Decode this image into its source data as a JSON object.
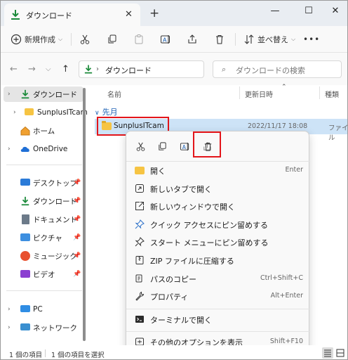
{
  "tab": {
    "title": "ダウンロード"
  },
  "window": {
    "new_tab": "+",
    "minimize": "—",
    "maximize": "☐",
    "close": "✕"
  },
  "toolbar": {
    "new_label": "新規作成",
    "sort_label": "並べ替え",
    "more": "•••"
  },
  "address": {
    "path": "ダウンロード",
    "chevron": "›",
    "search_placeholder": "ダウンロードの検索"
  },
  "sidebar": {
    "items": [
      {
        "label": "ダウンロード",
        "icon": "download-icon",
        "expander": "›"
      },
      {
        "label": "SunplusITcam",
        "icon": "folder-icon",
        "expander": "›"
      },
      {
        "label": "ホーム",
        "icon": "home-icon"
      },
      {
        "label": "OneDrive",
        "icon": "cloud-icon",
        "expander": "›"
      },
      {
        "label": "デスクトップ",
        "icon": "desktop-icon"
      },
      {
        "label": "ダウンロード",
        "icon": "download-icon"
      },
      {
        "label": "ドキュメント",
        "icon": "document-icon"
      },
      {
        "label": "ピクチャ",
        "icon": "pictures-icon"
      },
      {
        "label": "ミュージック",
        "icon": "music-icon"
      },
      {
        "label": "ビデオ",
        "icon": "video-icon"
      },
      {
        "label": "PC",
        "icon": "pc-icon",
        "expander": "›"
      },
      {
        "label": "ネットワーク",
        "icon": "network-icon",
        "expander": "›"
      }
    ]
  },
  "columns": {
    "name": "名前",
    "modified": "更新日時",
    "type": "種類"
  },
  "group": {
    "label": "先月",
    "expander": "∨"
  },
  "files": [
    {
      "name": "SunplusITcam",
      "date": "2022/11/17 18:08",
      "type": "ファイル"
    }
  ],
  "context_menu": {
    "items": [
      {
        "label": "開く",
        "shortcut": "Enter",
        "icon": "open-folder-icon"
      },
      {
        "label": "新しいタブで開く",
        "shortcut": "",
        "icon": "new-tab-icon"
      },
      {
        "label": "新しいウィンドウで開く",
        "shortcut": "",
        "icon": "new-window-icon"
      },
      {
        "label": "クイック アクセスにピン留めする",
        "shortcut": "",
        "icon": "pin-icon"
      },
      {
        "label": "スタート メニューにピン留めする",
        "shortcut": "",
        "icon": "pin-icon"
      },
      {
        "label": "ZIP ファイルに圧縮する",
        "shortcut": "",
        "icon": "zip-icon"
      },
      {
        "label": "パスのコピー",
        "shortcut": "Ctrl+Shift+C",
        "icon": "copy-path-icon"
      },
      {
        "label": "プロパティ",
        "shortcut": "Alt+Enter",
        "icon": "properties-icon"
      },
      {
        "label": "ターミナルで開く",
        "shortcut": "",
        "icon": "terminal-icon"
      },
      {
        "label": "その他のオプションを表示",
        "shortcut": "Shift+F10",
        "icon": "more-options-icon"
      }
    ]
  },
  "status": {
    "count": "1 個の項目",
    "selected": "1 個の項目を選択"
  },
  "colors": {
    "accent": "#1a5fb4",
    "selection": "#cde3f7",
    "highlight": "#e3151a",
    "download_green": "#1b8a3a"
  }
}
